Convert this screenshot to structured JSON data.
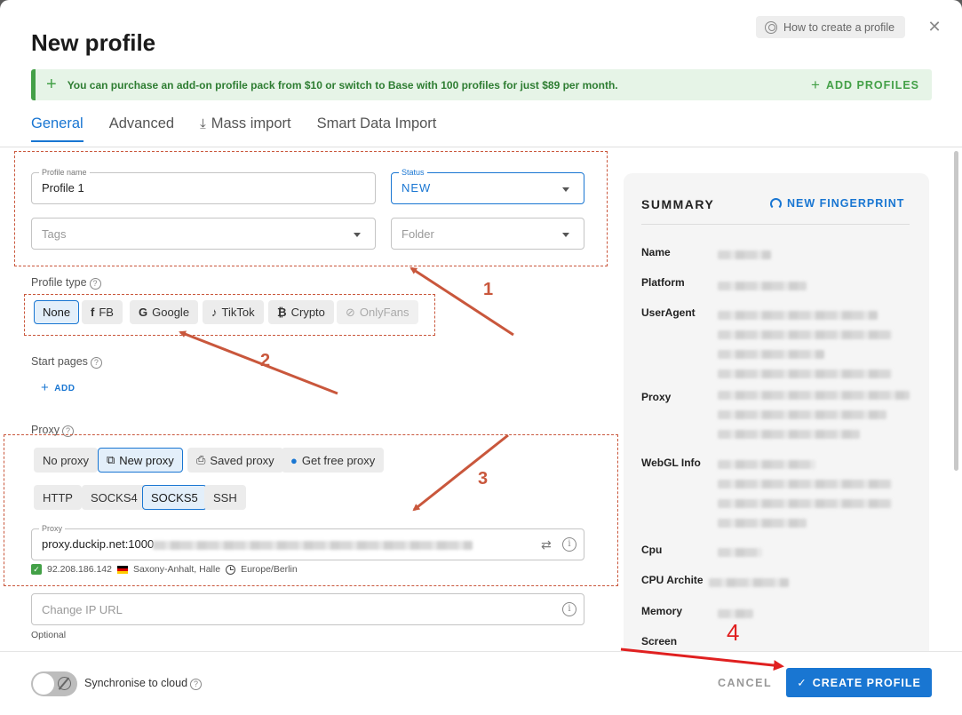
{
  "dialog": {
    "title": "New profile",
    "help_label": "How to create a profile",
    "close_icon": "close-icon"
  },
  "banner": {
    "message": "You can purchase an add-on profile pack from $10 or switch to Base with 100 profiles for just $89 per month.",
    "action_label": "ADD PROFILES",
    "accent": "#43a047"
  },
  "tabs": [
    {
      "label": "General",
      "active": true
    },
    {
      "label": "Advanced",
      "active": false
    },
    {
      "label": "Mass import",
      "active": false,
      "icon": "download-icon"
    },
    {
      "label": "Smart Data Import",
      "active": false
    }
  ],
  "form": {
    "profile_name": {
      "label": "Profile name",
      "value": "Profile 1"
    },
    "status": {
      "label": "Status",
      "value": "NEW"
    },
    "tags": {
      "placeholder": "Tags"
    },
    "folder": {
      "placeholder": "Folder"
    },
    "profile_type": {
      "label": "Profile type",
      "options": [
        {
          "label": "None",
          "icon": "",
          "selected": true
        },
        {
          "label": "FB",
          "icon": "f"
        },
        {
          "label": "Google",
          "icon": "G"
        },
        {
          "label": "TikTok",
          "icon": "♪"
        },
        {
          "label": "Crypto",
          "icon": "₿"
        },
        {
          "label": "OnlyFans",
          "icon": "⊘",
          "disabled": true
        }
      ]
    },
    "start_pages": {
      "label": "Start pages",
      "add_label": "ADD"
    },
    "proxy": {
      "label": "Proxy",
      "modes": [
        {
          "label": "No proxy"
        },
        {
          "label": "New proxy",
          "selected": true,
          "icon": "new-proxy-icon"
        },
        {
          "label": "Saved proxy",
          "icon": "bookmark-icon"
        },
        {
          "label": "Get free proxy",
          "icon": "drop-icon"
        }
      ],
      "protocols": [
        {
          "label": "HTTP"
        },
        {
          "label": "SOCKS4"
        },
        {
          "label": "SOCKS5",
          "selected": true
        },
        {
          "label": "SSH"
        }
      ],
      "field_label": "Proxy",
      "field_value": "proxy.duckip.net:1000",
      "ip": "92.208.186.142",
      "location": "Saxony-Anhalt, Halle",
      "timezone": "Europe/Berlin"
    },
    "change_ip_url": {
      "placeholder": "Change IP URL",
      "helper": "Optional"
    }
  },
  "summary": {
    "title": "SUMMARY",
    "fingerprint_action": "NEW FINGERPRINT",
    "rows": [
      {
        "key": "Name"
      },
      {
        "key": "Platform"
      },
      {
        "key": "UserAgent"
      },
      {
        "key": "Proxy"
      },
      {
        "key": "WebGL Info"
      },
      {
        "key": "Cpu"
      },
      {
        "key": "CPU Archite"
      },
      {
        "key": "Memory"
      },
      {
        "key": "Screen"
      }
    ]
  },
  "footer": {
    "sync_label": "Synchronise to cloud",
    "cancel_label": "CANCEL",
    "create_label": "CREATE PROFILE"
  },
  "annotations": {
    "n1": "1",
    "n2": "2",
    "n3": "3",
    "n4": "4",
    "color": "#c9573c",
    "arrow4_color": "#e02020"
  }
}
